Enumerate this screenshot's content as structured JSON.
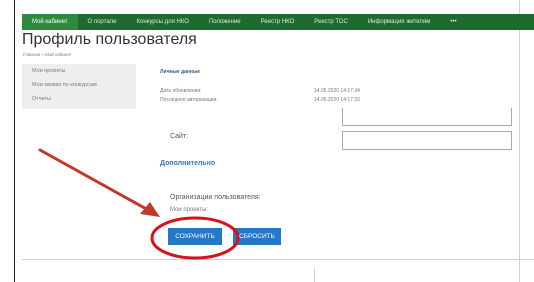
{
  "nav": {
    "items": [
      {
        "label": "Мой кабинет"
      },
      {
        "label": "О портале"
      },
      {
        "label": "Конкурсы для НКО"
      },
      {
        "label": "Положение"
      },
      {
        "label": "Реестр НКО"
      },
      {
        "label": "Реестр ТОС"
      },
      {
        "label": "Информация жителям"
      },
      {
        "label": "•••"
      }
    ],
    "accent_color": "#1f6b2f"
  },
  "page": {
    "title": "Профиль пользователя",
    "breadcrumb": "Главная » Мой кабинет"
  },
  "sidebar": {
    "items": [
      {
        "label": "Мои проекты"
      },
      {
        "label": "Мои заявки по конкурсам"
      },
      {
        "label": "Отчеты"
      }
    ]
  },
  "personal": {
    "section_title": "Личные данные",
    "updated_label": "Дата обновления:",
    "updated_value": "14.05.2020 14:17:34",
    "last_login_label": "Последняя авторизация:",
    "last_login_value": "14.05.2020 14:17:33"
  },
  "form": {
    "site_label": "Сайт:",
    "additional_title": "Дополнительно",
    "organizations_label": "Организации пользователя:",
    "projects_label": "Мои проекты:"
  },
  "buttons": {
    "save": "СОХРАНИТЬ",
    "reset": "СБРОСИТЬ",
    "color": "#2577c7"
  },
  "annotation": {
    "arrow_color": "#c0392b",
    "circle_color": "#d4141a"
  }
}
